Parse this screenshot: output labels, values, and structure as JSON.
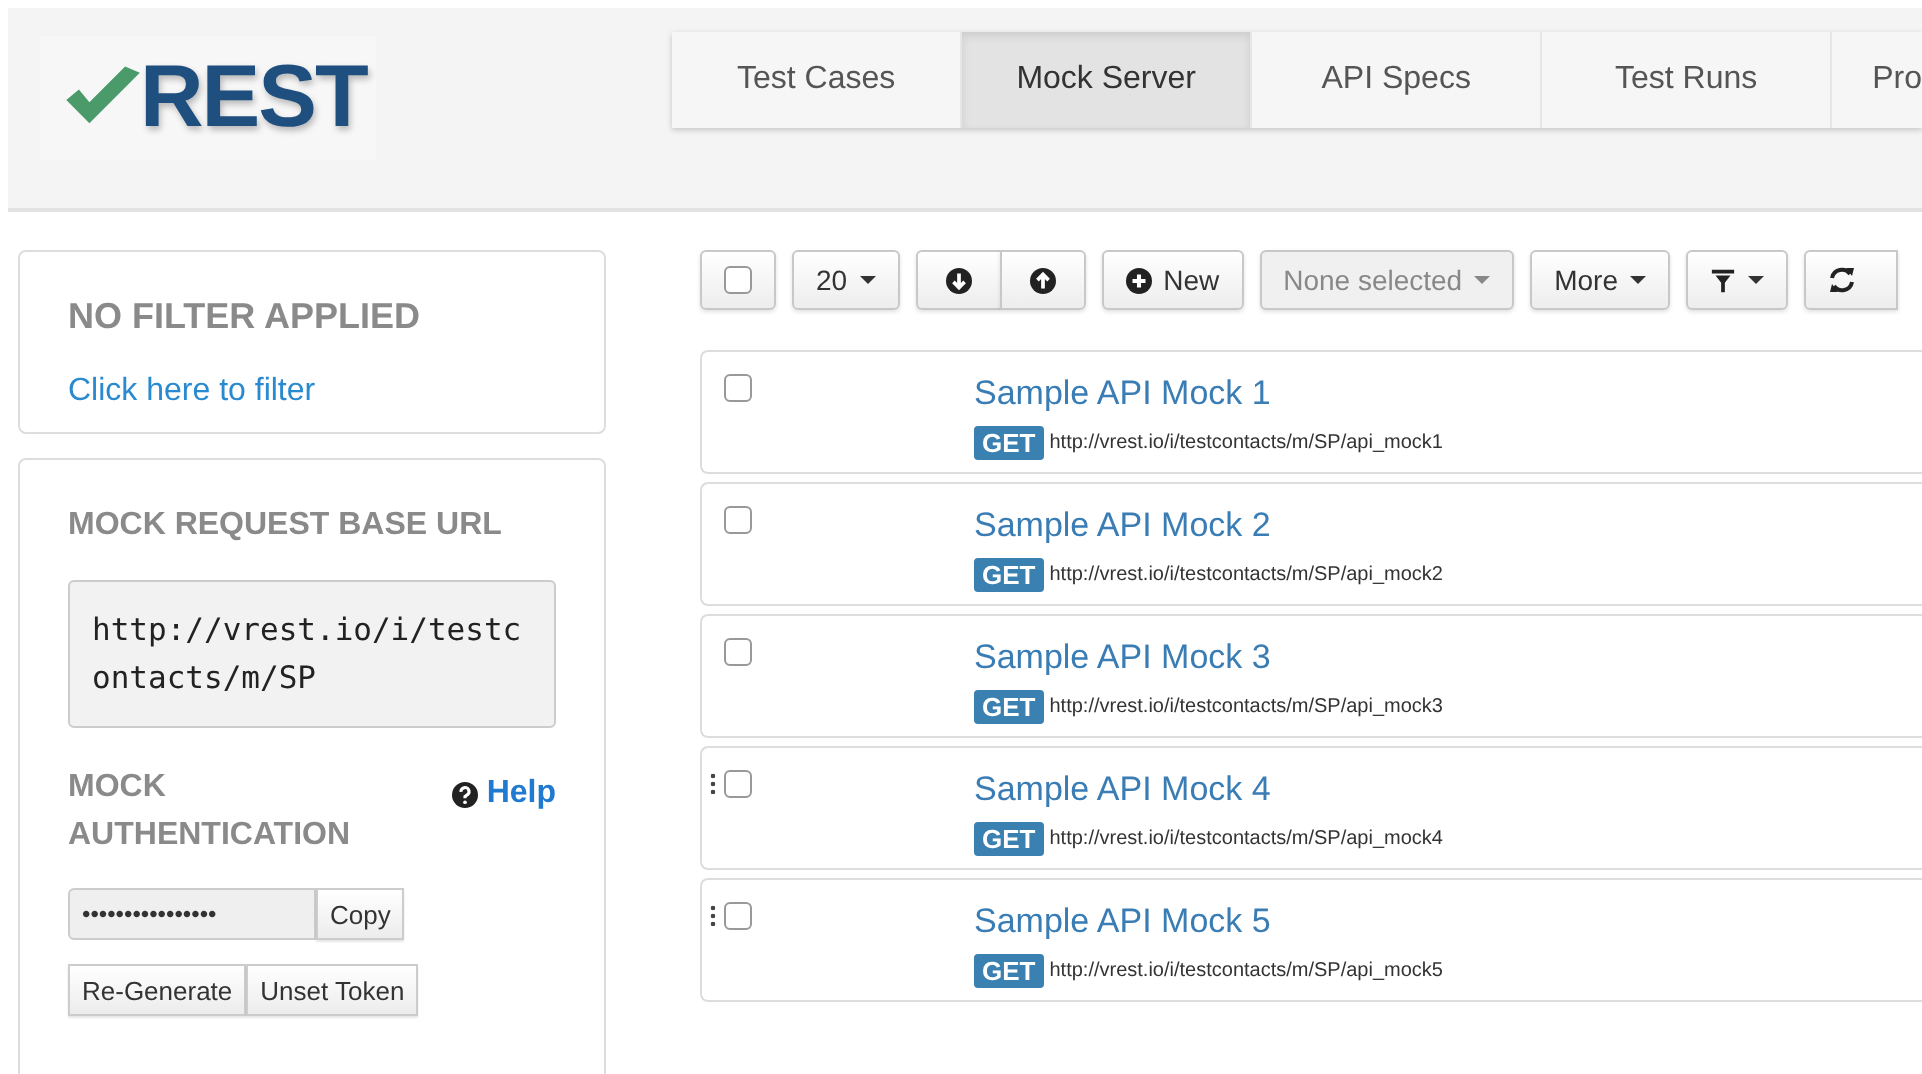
{
  "logo": {
    "text": "REST"
  },
  "tabs": [
    {
      "label": "Test Cases",
      "selected": false
    },
    {
      "label": "Mock Server",
      "selected": true
    },
    {
      "label": "API Specs",
      "selected": false
    },
    {
      "label": "Test Runs",
      "selected": false
    },
    {
      "label": "Pro",
      "selected": false
    }
  ],
  "filter_panel": {
    "title": "NO FILTER APPLIED",
    "link": "Click here to filter"
  },
  "mock_panel": {
    "base_url_title": "MOCK REQUEST BASE URL",
    "base_url": "http://vrest.io/i/testcontacts/m/SP",
    "auth_title": "MOCK AUTHENTICATION",
    "help": "Help",
    "token": "••••••••••••••••",
    "copy": "Copy",
    "regenerate": "Re-Generate",
    "unset": "Unset Token"
  },
  "toolbar": {
    "page_size": "20",
    "new": "New",
    "selection": "None selected",
    "more": "More"
  },
  "mocks": [
    {
      "name": "Sample API Mock 1",
      "method": "GET",
      "url": "http://vrest.io/i/testcontacts/m/SP/api_mock1",
      "checked": false,
      "drag_handle": false
    },
    {
      "name": "Sample API Mock 2",
      "method": "GET",
      "url": "http://vrest.io/i/testcontacts/m/SP/api_mock2",
      "checked": false,
      "drag_handle": false
    },
    {
      "name": "Sample API Mock 3",
      "method": "GET",
      "url": "http://vrest.io/i/testcontacts/m/SP/api_mock3",
      "checked": false,
      "drag_handle": false
    },
    {
      "name": "Sample API Mock 4",
      "method": "GET",
      "url": "http://vrest.io/i/testcontacts/m/SP/api_mock4",
      "checked": false,
      "drag_handle": true
    },
    {
      "name": "Sample API Mock 5",
      "method": "GET",
      "url": "http://vrest.io/i/testcontacts/m/SP/api_mock5",
      "checked": false,
      "drag_handle": true
    }
  ]
}
